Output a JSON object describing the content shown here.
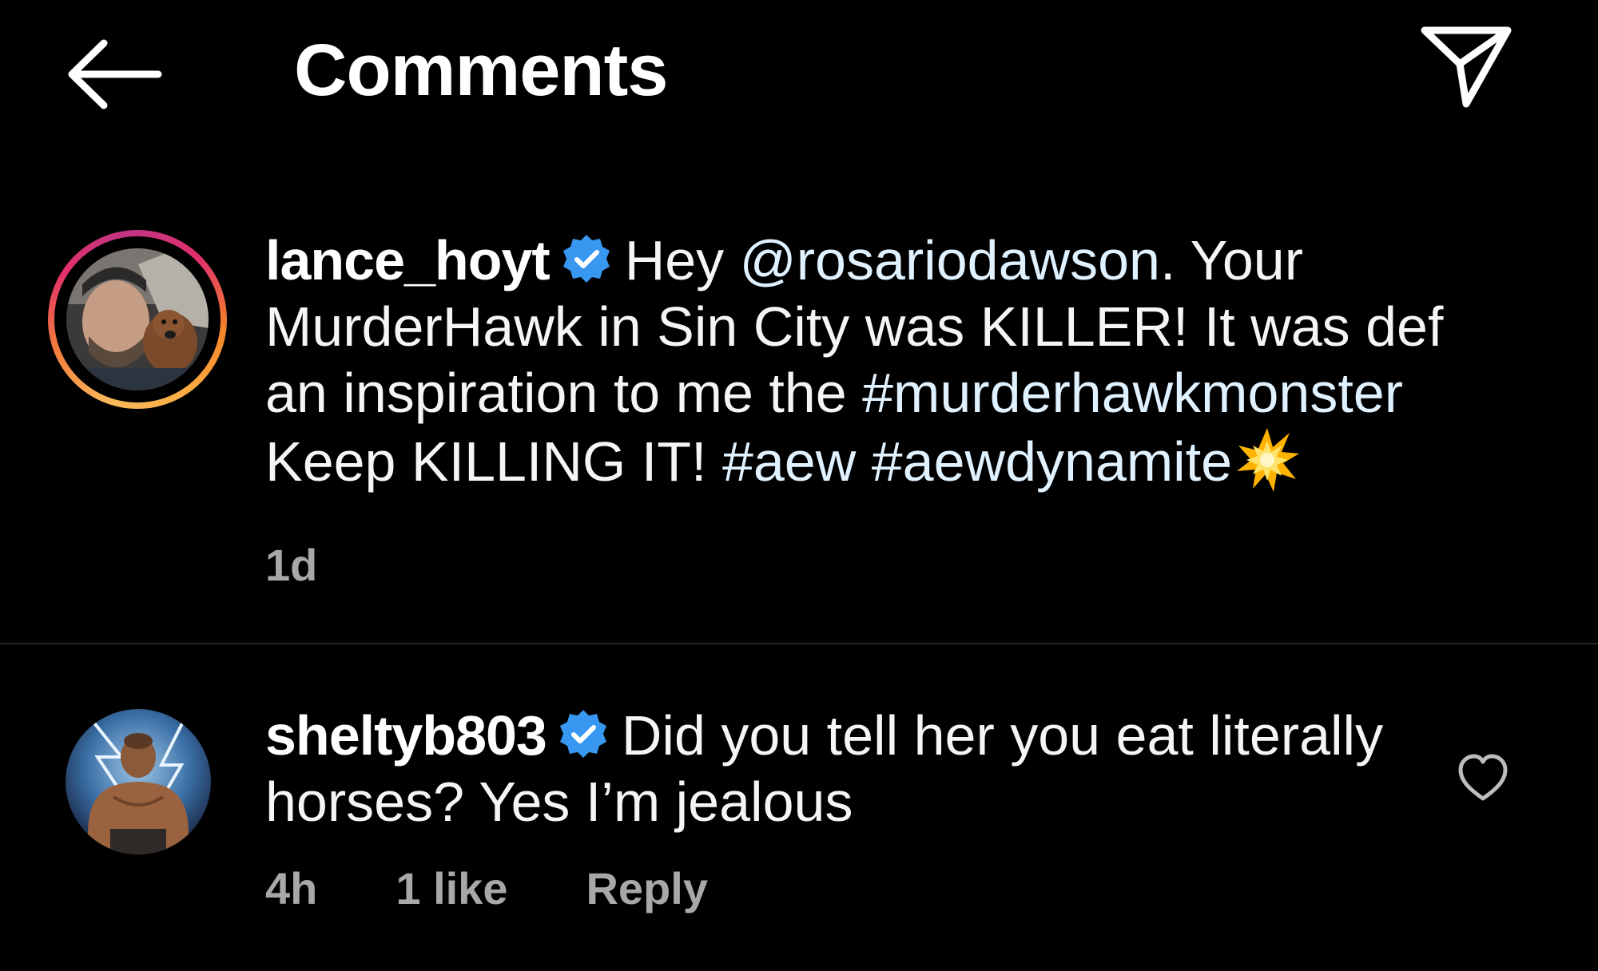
{
  "header": {
    "title": "Comments",
    "back_icon": "arrow-left-icon",
    "share_icon": "paper-plane-icon"
  },
  "caption": {
    "username": "lance_hoyt",
    "verified": true,
    "text_prefix": "Hey ",
    "mention": "@rosariodawson",
    "text_middle": ". Your MurderHawk in Sin City was KILLER! It was def an inspiration to me the ",
    "hashtag_1": "#murderhawkmonster",
    "text_after_1": " Keep KILLING IT! ",
    "hashtag_2": "#aew",
    "hashtag_3": "#aewdynamite",
    "emoji": "collision-emoji",
    "time": "1d"
  },
  "reply": {
    "username": "sheltyb803",
    "verified": true,
    "text": "Did you tell her you eat literally horses? Yes I’m jealous",
    "time": "4h",
    "likes": "1 like",
    "reply_label": "Reply",
    "like_icon": "heart-outline-icon"
  },
  "colors": {
    "background": "#000000",
    "text": "#f5f5f5",
    "meta": "#a8a8a8",
    "link": "#e0f1ff",
    "verified": "#3897f0",
    "divider": "#262626"
  }
}
